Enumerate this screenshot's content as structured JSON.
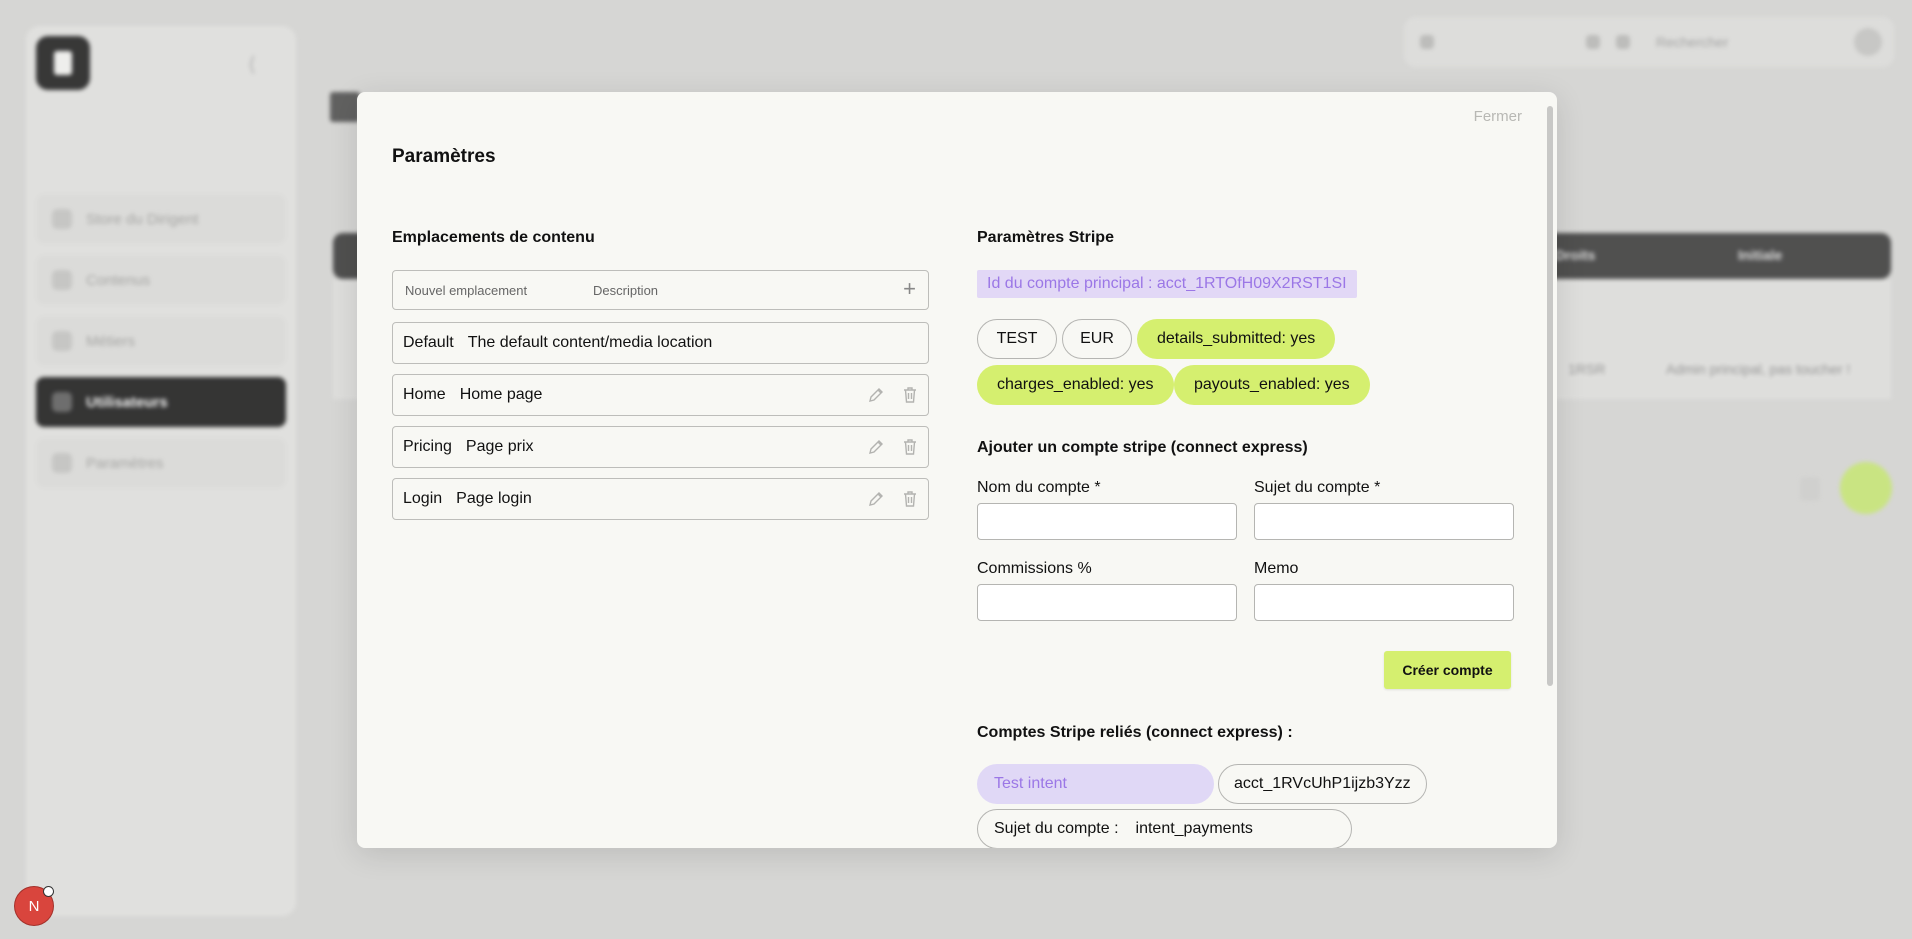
{
  "modal": {
    "close_label": "Fermer",
    "title": "Paramètres"
  },
  "locations": {
    "title": "Emplacements de contenu",
    "new_placeholder": "Nouvel emplacement",
    "description_placeholder": "Description",
    "add_icon": "+",
    "items": [
      {
        "name": "Default",
        "description": "The default content/media location",
        "editable": false
      },
      {
        "name": "Home",
        "description": "Home page",
        "editable": true
      },
      {
        "name": "Pricing",
        "description": "Page prix",
        "editable": true
      },
      {
        "name": "Login",
        "description": "Page login",
        "editable": true
      }
    ]
  },
  "stripe": {
    "title": "Paramètres Stripe",
    "main_account_label": "Id du compte principal : acct_1RTOfH09X2RST1SI",
    "chips": [
      "TEST",
      "EUR",
      "details_submitted: yes",
      "charges_enabled: yes",
      "payouts_enabled: yes"
    ],
    "add_title": "Ajouter un compte stripe (connect express)",
    "fields": {
      "account_name": "Nom du compte *",
      "account_subject": "Sujet du compte *",
      "commissions": "Commissions %",
      "memo": "Memo"
    },
    "create_button": "Créer compte",
    "linked_title": "Comptes Stripe reliés (connect express) :",
    "linked": {
      "name": "Test intent",
      "id": "acct_1RVcUhP1ijzb3Yzz",
      "subject_label": "Sujet du compte :",
      "subject_value": "intent_payments"
    }
  },
  "background": {
    "nav_items": [
      "Store du Dirigent",
      "Contenus",
      "Métiers",
      "Utilisateurs",
      "Paramètres"
    ],
    "search_placeholder": "Rechercher",
    "table_headers": [
      "Droits",
      "Initiale"
    ],
    "cell_values": [
      "1RSR",
      "Admin principal, pas toucher !"
    ],
    "badge_letter": "N"
  }
}
